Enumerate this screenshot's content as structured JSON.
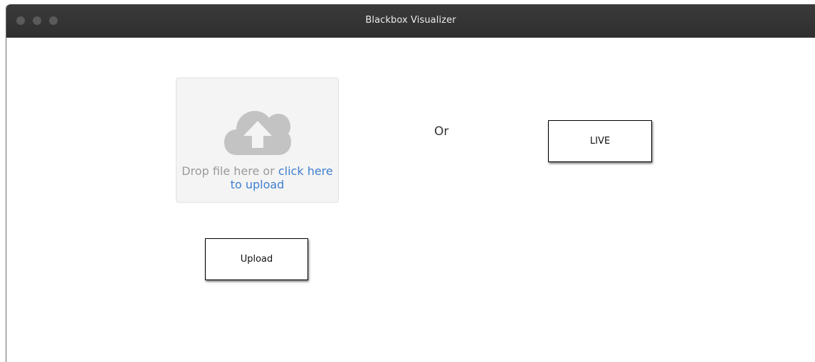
{
  "window": {
    "title": "Blackbox Visualizer"
  },
  "dropzone": {
    "text_prefix": "Drop file here or ",
    "link_text": "click here to upload",
    "icon": "cloud-upload-icon"
  },
  "separator": {
    "label": "Or"
  },
  "buttons": {
    "live_label": "LIVE",
    "upload_label": "Upload"
  },
  "colors": {
    "titlebar": "#333333",
    "link": "#3f7fcf",
    "dropzone_bg": "#f4f4f4",
    "icon_gray": "#c3c3c3"
  }
}
